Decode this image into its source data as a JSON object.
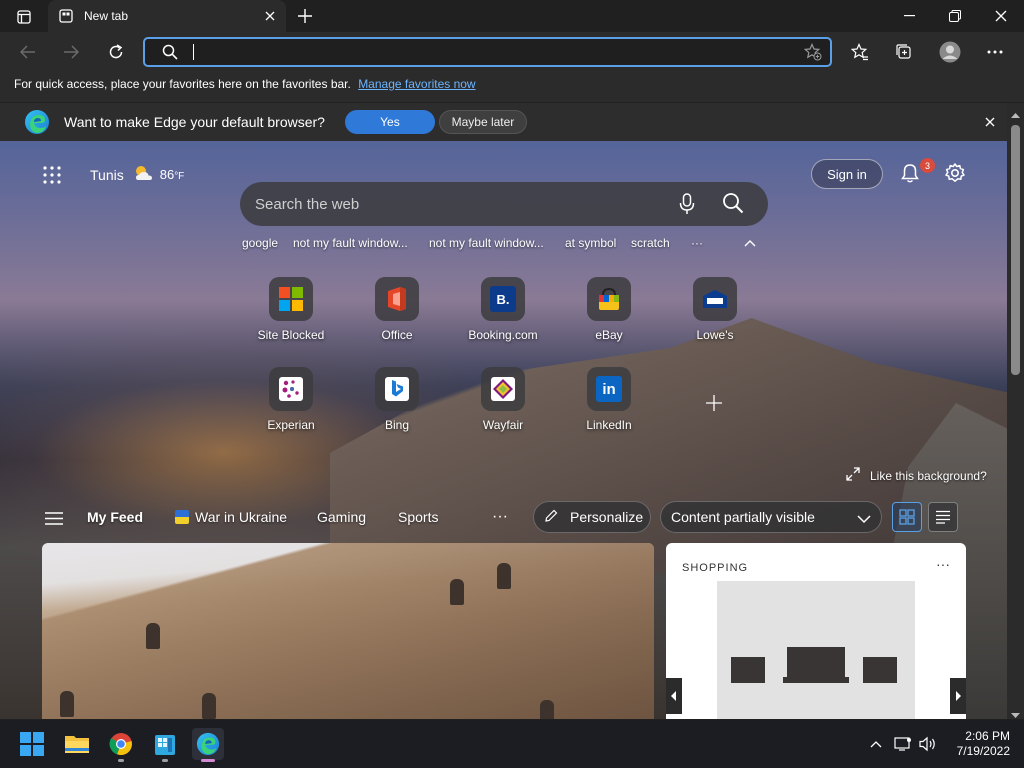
{
  "browser": {
    "tab_title": "New tab",
    "address_value": "",
    "favorites_bar_text": "For quick access, place your favorites here on the favorites bar.",
    "manage_favorites_link": "Manage favorites now"
  },
  "banner": {
    "message": "Want to make Edge your default browser?",
    "yes_label": "Yes",
    "later_label": "Maybe later"
  },
  "header": {
    "city": "Tunis",
    "temperature": "86",
    "temp_unit": "°F",
    "sign_in": "Sign in",
    "notification_count": "3"
  },
  "search": {
    "placeholder": "Search the web",
    "trending": [
      "google",
      "not my fault window...",
      "not my fault window...",
      "at symbol",
      "scratch"
    ],
    "more": "···"
  },
  "quick_links": [
    {
      "label": "Site Blocked",
      "icon": "microsoft-logo"
    },
    {
      "label": "Office",
      "icon": "office-logo"
    },
    {
      "label": "Booking.com",
      "icon": "booking-logo",
      "glyph": "B."
    },
    {
      "label": "eBay",
      "icon": "ebay-logo"
    },
    {
      "label": "Lowe's",
      "icon": "lowes-logo"
    },
    {
      "label": "Experian",
      "icon": "experian-logo"
    },
    {
      "label": "Bing",
      "icon": "bing-logo"
    },
    {
      "label": "Wayfair",
      "icon": "wayfair-logo"
    },
    {
      "label": "LinkedIn",
      "icon": "linkedin-logo",
      "glyph": "in"
    }
  ],
  "background": {
    "like_text": "Like this background?"
  },
  "feed": {
    "tabs": [
      "My Feed",
      "War in Ukraine",
      "Gaming",
      "Sports"
    ],
    "more": "···",
    "personalize": "Personalize",
    "content_visibility": "Content partially visible"
  },
  "shopping_card": {
    "label": "SHOPPING",
    "menu": "···"
  },
  "taskbar": {
    "time": "2:06 PM",
    "date": "7/19/2022"
  },
  "colors": {
    "accent": "#2f7ad8",
    "link": "#6cb4ff",
    "badge": "#d94b3d"
  }
}
